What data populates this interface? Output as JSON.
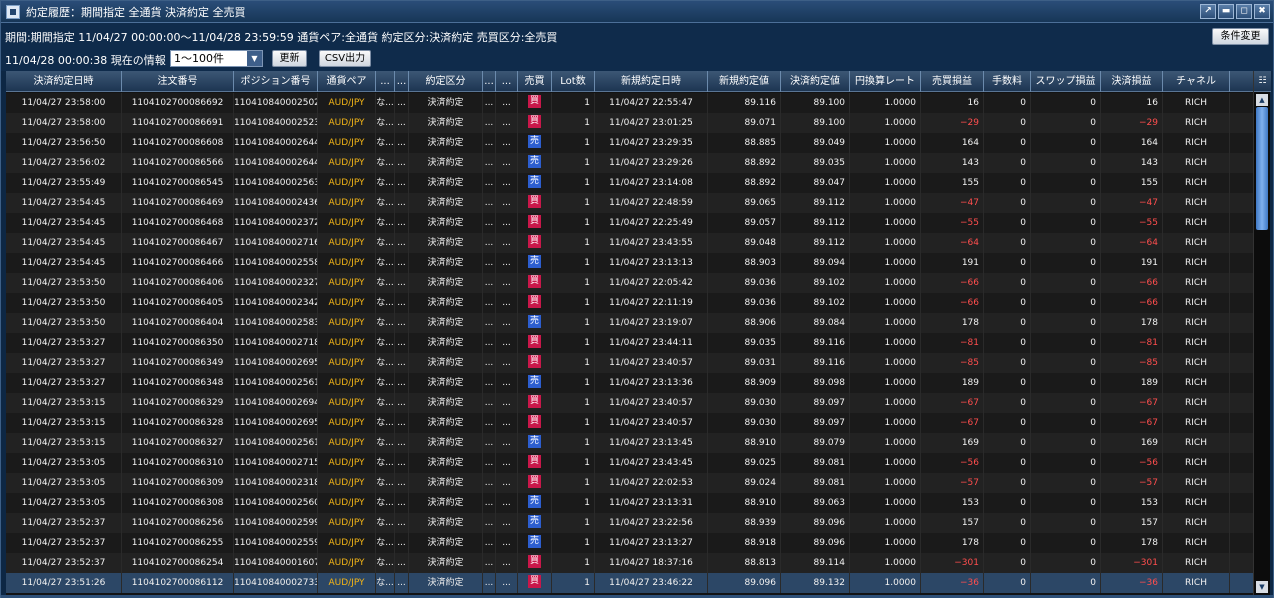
{
  "window": {
    "title": "約定履歴：期間指定 全通貨 決済約定 全売買",
    "buttons": [
      "↗",
      "▬",
      "◻",
      "✖"
    ]
  },
  "info": {
    "period_text": "期間:期間指定  11/04/27 00:00:00〜11/04/28 23:59:59   通貨ペア:全通貨   約定区分:決済約定   売買区分:全売買",
    "current_text": "11/04/28 00:00:38 現在の情報",
    "range_value": "1〜100件",
    "update_label": "更新",
    "csv_label": "CSV出力",
    "condition_label": "条件変更"
  },
  "columns": [
    "決済約定日時",
    "注文番号",
    "ポジション番号",
    "通貨ペア",
    "...",
    "...",
    "約定区分",
    "...",
    "...",
    "売買",
    "Lot数",
    "新規約定日時",
    "新規約定値",
    "決済約定値",
    "円換算レート",
    "売買損益",
    "手数料",
    "スワップ損益",
    "決済損益",
    "チャネル"
  ],
  "column_menu_icon": "column-chooser-icon",
  "rows": [
    [
      "11/04/27 23:58:00",
      "110410270008669​2",
      "110410840002502​0",
      "AUD/JPY",
      "な...",
      "...",
      "決済約定",
      "...",
      "...",
      "買",
      "1",
      "11/04/27 22:55:47",
      "89.116",
      "89.100",
      "1.0000",
      "16",
      "0",
      "0",
      "16",
      "RICH"
    ],
    [
      "11/04/27 23:58:00",
      "1104102700086691",
      "1104108400025230",
      "AUD/JPY",
      "な...",
      "...",
      "決済約定",
      "...",
      "...",
      "買",
      "1",
      "11/04/27 23:01:25",
      "89.071",
      "89.100",
      "1.0000",
      "−29",
      "0",
      "0",
      "−29",
      "RICH"
    ],
    [
      "11/04/27 23:56:50",
      "1104102700086608",
      "1104108400026446",
      "AUD/JPY",
      "な...",
      "...",
      "決済約定",
      "...",
      "...",
      "売",
      "1",
      "11/04/27 23:29:35",
      "88.885",
      "89.049",
      "1.0000",
      "164",
      "0",
      "0",
      "164",
      "RICH"
    ],
    [
      "11/04/27 23:56:02",
      "1104102700086566",
      "1104108400026441",
      "AUD/JPY",
      "な...",
      "...",
      "決済約定",
      "...",
      "...",
      "売",
      "1",
      "11/04/27 23:29:26",
      "88.892",
      "89.035",
      "1.0000",
      "143",
      "0",
      "0",
      "143",
      "RICH"
    ],
    [
      "11/04/27 23:55:49",
      "1104102700086545",
      "1104108400025639",
      "AUD/JPY",
      "な...",
      "...",
      "決済約定",
      "...",
      "...",
      "売",
      "1",
      "11/04/27 23:14:08",
      "88.892",
      "89.047",
      "1.0000",
      "155",
      "0",
      "0",
      "155",
      "RICH"
    ],
    [
      "11/04/27 23:54:45",
      "1104102700086469",
      "1104108400024361",
      "AUD/JPY",
      "な...",
      "...",
      "決済約定",
      "...",
      "...",
      "買",
      "1",
      "11/04/27 22:48:59",
      "89.065",
      "89.112",
      "1.0000",
      "−47",
      "0",
      "0",
      "−47",
      "RICH"
    ],
    [
      "11/04/27 23:54:45",
      "1104102700086468",
      "1104108400023726",
      "AUD/JPY",
      "な...",
      "...",
      "決済約定",
      "...",
      "...",
      "買",
      "1",
      "11/04/27 22:25:49",
      "89.057",
      "89.112",
      "1.0000",
      "−55",
      "0",
      "0",
      "−55",
      "RICH"
    ],
    [
      "11/04/27 23:54:45",
      "1104102700086467",
      "1104108400027166",
      "AUD/JPY",
      "な...",
      "...",
      "決済約定",
      "...",
      "...",
      "買",
      "1",
      "11/04/27 23:43:55",
      "89.048",
      "89.112",
      "1.0000",
      "−64",
      "0",
      "0",
      "−64",
      "RICH"
    ],
    [
      "11/04/27 23:54:45",
      "1104102700086466",
      "1104108400025585",
      "AUD/JPY",
      "な...",
      "...",
      "決済約定",
      "...",
      "...",
      "売",
      "1",
      "11/04/27 23:13:13",
      "88.903",
      "89.094",
      "1.0000",
      "191",
      "0",
      "0",
      "191",
      "RICH"
    ],
    [
      "11/04/27 23:53:50",
      "1104102700086406",
      "1104108400023271",
      "AUD/JPY",
      "な...",
      "...",
      "決済約定",
      "...",
      "...",
      "買",
      "1",
      "11/04/27 22:05:42",
      "89.036",
      "89.102",
      "1.0000",
      "−66",
      "0",
      "0",
      "−66",
      "RICH"
    ],
    [
      "11/04/27 23:53:50",
      "1104102700086405",
      "1104108400023429",
      "AUD/JPY",
      "な...",
      "...",
      "決済約定",
      "...",
      "...",
      "買",
      "1",
      "11/04/27 22:11:19",
      "89.036",
      "89.102",
      "1.0000",
      "−66",
      "0",
      "0",
      "−66",
      "RICH"
    ],
    [
      "11/04/27 23:53:50",
      "1104102700086404",
      "1104108400025835",
      "AUD/JPY",
      "な...",
      "...",
      "決済約定",
      "...",
      "...",
      "売",
      "1",
      "11/04/27 23:19:07",
      "88.906",
      "89.084",
      "1.0000",
      "178",
      "0",
      "0",
      "178",
      "RICH"
    ],
    [
      "11/04/27 23:53:27",
      "1104102700086350",
      "1104108400027184",
      "AUD/JPY",
      "な...",
      "...",
      "決済約定",
      "...",
      "...",
      "買",
      "1",
      "11/04/27 23:44:11",
      "89.035",
      "89.116",
      "1.0000",
      "−81",
      "0",
      "0",
      "−81",
      "RICH"
    ],
    [
      "11/04/27 23:53:27",
      "1104102700086349",
      "1104108400026951",
      "AUD/JPY",
      "な...",
      "...",
      "決済約定",
      "...",
      "...",
      "買",
      "1",
      "11/04/27 23:40:57",
      "89.031",
      "89.116",
      "1.0000",
      "−85",
      "0",
      "0",
      "−85",
      "RICH"
    ],
    [
      "11/04/27 23:53:27",
      "1104102700086348",
      "1104108400025612",
      "AUD/JPY",
      "な...",
      "...",
      "決済約定",
      "...",
      "...",
      "売",
      "1",
      "11/04/27 23:13:36",
      "88.909",
      "89.098",
      "1.0000",
      "189",
      "0",
      "0",
      "189",
      "RICH"
    ],
    [
      "11/04/27 23:53:15",
      "1104102700086329",
      "1104108400026949",
      "AUD/JPY",
      "な...",
      "...",
      "決済約定",
      "...",
      "...",
      "買",
      "1",
      "11/04/27 23:40:57",
      "89.030",
      "89.097",
      "1.0000",
      "−67",
      "0",
      "0",
      "−67",
      "RICH"
    ],
    [
      "11/04/27 23:53:15",
      "1104102700086328",
      "1104108400026950",
      "AUD/JPY",
      "な...",
      "...",
      "決済約定",
      "...",
      "...",
      "買",
      "1",
      "11/04/27 23:40:57",
      "89.030",
      "89.097",
      "1.0000",
      "−67",
      "0",
      "0",
      "−67",
      "RICH"
    ],
    [
      "11/04/27 23:53:15",
      "1104102700086327",
      "1104108400025616",
      "AUD/JPY",
      "な...",
      "...",
      "決済約定",
      "...",
      "...",
      "売",
      "1",
      "11/04/27 23:13:45",
      "88.910",
      "89.079",
      "1.0000",
      "169",
      "0",
      "0",
      "169",
      "RICH"
    ],
    [
      "11/04/27 23:53:05",
      "1104102700086310",
      "1104108400027158",
      "AUD/JPY",
      "な...",
      "...",
      "決済約定",
      "...",
      "...",
      "買",
      "1",
      "11/04/27 23:43:45",
      "89.025",
      "89.081",
      "1.0000",
      "−56",
      "0",
      "0",
      "−56",
      "RICH"
    ],
    [
      "11/04/27 23:53:05",
      "1104102700086309",
      "1104108400023183",
      "AUD/JPY",
      "な...",
      "...",
      "決済約定",
      "...",
      "...",
      "買",
      "1",
      "11/04/27 22:02:53",
      "89.024",
      "89.081",
      "1.0000",
      "−57",
      "0",
      "0",
      "−57",
      "RICH"
    ],
    [
      "11/04/27 23:53:05",
      "1104102700086308",
      "1104108400025603",
      "AUD/JPY",
      "な...",
      "...",
      "決済約定",
      "...",
      "...",
      "売",
      "1",
      "11/04/27 23:13:31",
      "88.910",
      "89.063",
      "1.0000",
      "153",
      "0",
      "0",
      "153",
      "RICH"
    ],
    [
      "11/04/27 23:52:37",
      "1104102700086256",
      "1104108400025993",
      "AUD/JPY",
      "な...",
      "...",
      "決済約定",
      "...",
      "...",
      "売",
      "1",
      "11/04/27 23:22:56",
      "88.939",
      "89.096",
      "1.0000",
      "157",
      "0",
      "0",
      "157",
      "RICH"
    ],
    [
      "11/04/27 23:52:37",
      "1104102700086255",
      "1104108400025599",
      "AUD/JPY",
      "な...",
      "...",
      "決済約定",
      "...",
      "...",
      "売",
      "1",
      "11/04/27 23:13:27",
      "88.918",
      "89.096",
      "1.0000",
      "178",
      "0",
      "0",
      "178",
      "RICH"
    ],
    [
      "11/04/27 23:52:37",
      "1104102700086254",
      "1104108400016079",
      "AUD/JPY",
      "な...",
      "...",
      "決済約定",
      "...",
      "...",
      "買",
      "1",
      "11/04/27 18:37:16",
      "88.813",
      "89.114",
      "1.0000",
      "−301",
      "0",
      "0",
      "−301",
      "RICH"
    ],
    [
      "11/04/27 23:51:26",
      "1104102700086112",
      "1104108400027332",
      "AUD/JPY",
      "な...",
      "...",
      "決済約定",
      "...",
      "...",
      "買",
      "1",
      "11/04/27 23:46:22",
      "89.096",
      "89.132",
      "1.0000",
      "−36",
      "0",
      "0",
      "−36",
      "RICH"
    ]
  ],
  "colors": {
    "buy": "#c9174a",
    "sell": "#2d5ecf",
    "negative": "#ff4e4e",
    "pair": "#f2b417",
    "row_alt": "#222222",
    "row": "#1a1a1a",
    "selected": "#2c4766"
  }
}
